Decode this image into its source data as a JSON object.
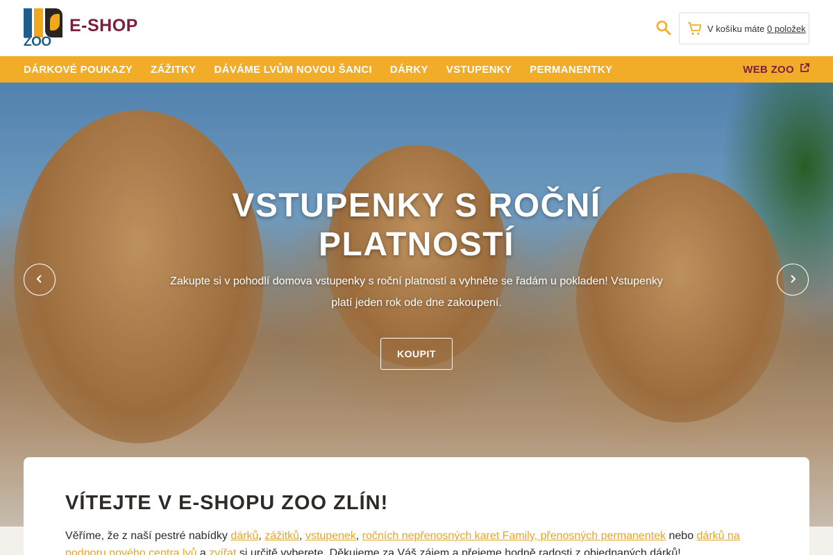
{
  "header": {
    "logo_text": "ZOO",
    "shop_title": "E-SHOP",
    "cart_prefix": "V košíku máte",
    "cart_link": "0 položek"
  },
  "nav": {
    "items": [
      "DÁRKOVÉ POUKAZY",
      "ZÁŽITKY",
      "DÁVÁME LVŮM NOVOU ŠANCI",
      "DÁRKY",
      "VSTUPENKY",
      "PERMANENTKY"
    ],
    "web_zoo": "WEB ZOO"
  },
  "hero": {
    "title": "VSTUPENKY S ROČNÍ PLATNOSTÍ",
    "text": "Zakupte si v pohodlí domova vstupenky s roční platností a vyhněte se řadám u pokladen! Vstupenky platí jeden rok ode dne zakoupení.",
    "button": "KOUPIT"
  },
  "welcome": {
    "title": "VÍTEJTE V E-SHOPU ZOO ZLÍN!",
    "p_start": "Věříme, že z naší pestré nabídky ",
    "link_1": "dárků",
    "sep_1": ", ",
    "link_2": "zážitků",
    "sep_2": ", ",
    "link_3": "vstupenek",
    "sep_3": ", ",
    "link_4": "ročních nepřenosných karet Family, přenosných permanentek",
    "sep_4": " nebo ",
    "link_5": "dárků na podporu nového centra lvů",
    "sep_5": " a ",
    "link_6": "zvířat",
    "p_end": " si určitě vyberete. Děkujeme za Váš zájem a přejeme hodně radosti z objednaných dárků!"
  },
  "colors": {
    "nav_bg": "#f2ac28",
    "brand_dark": "#7a1f3d",
    "link": "#e8a523",
    "logo_blue": "#1d5e8c"
  }
}
